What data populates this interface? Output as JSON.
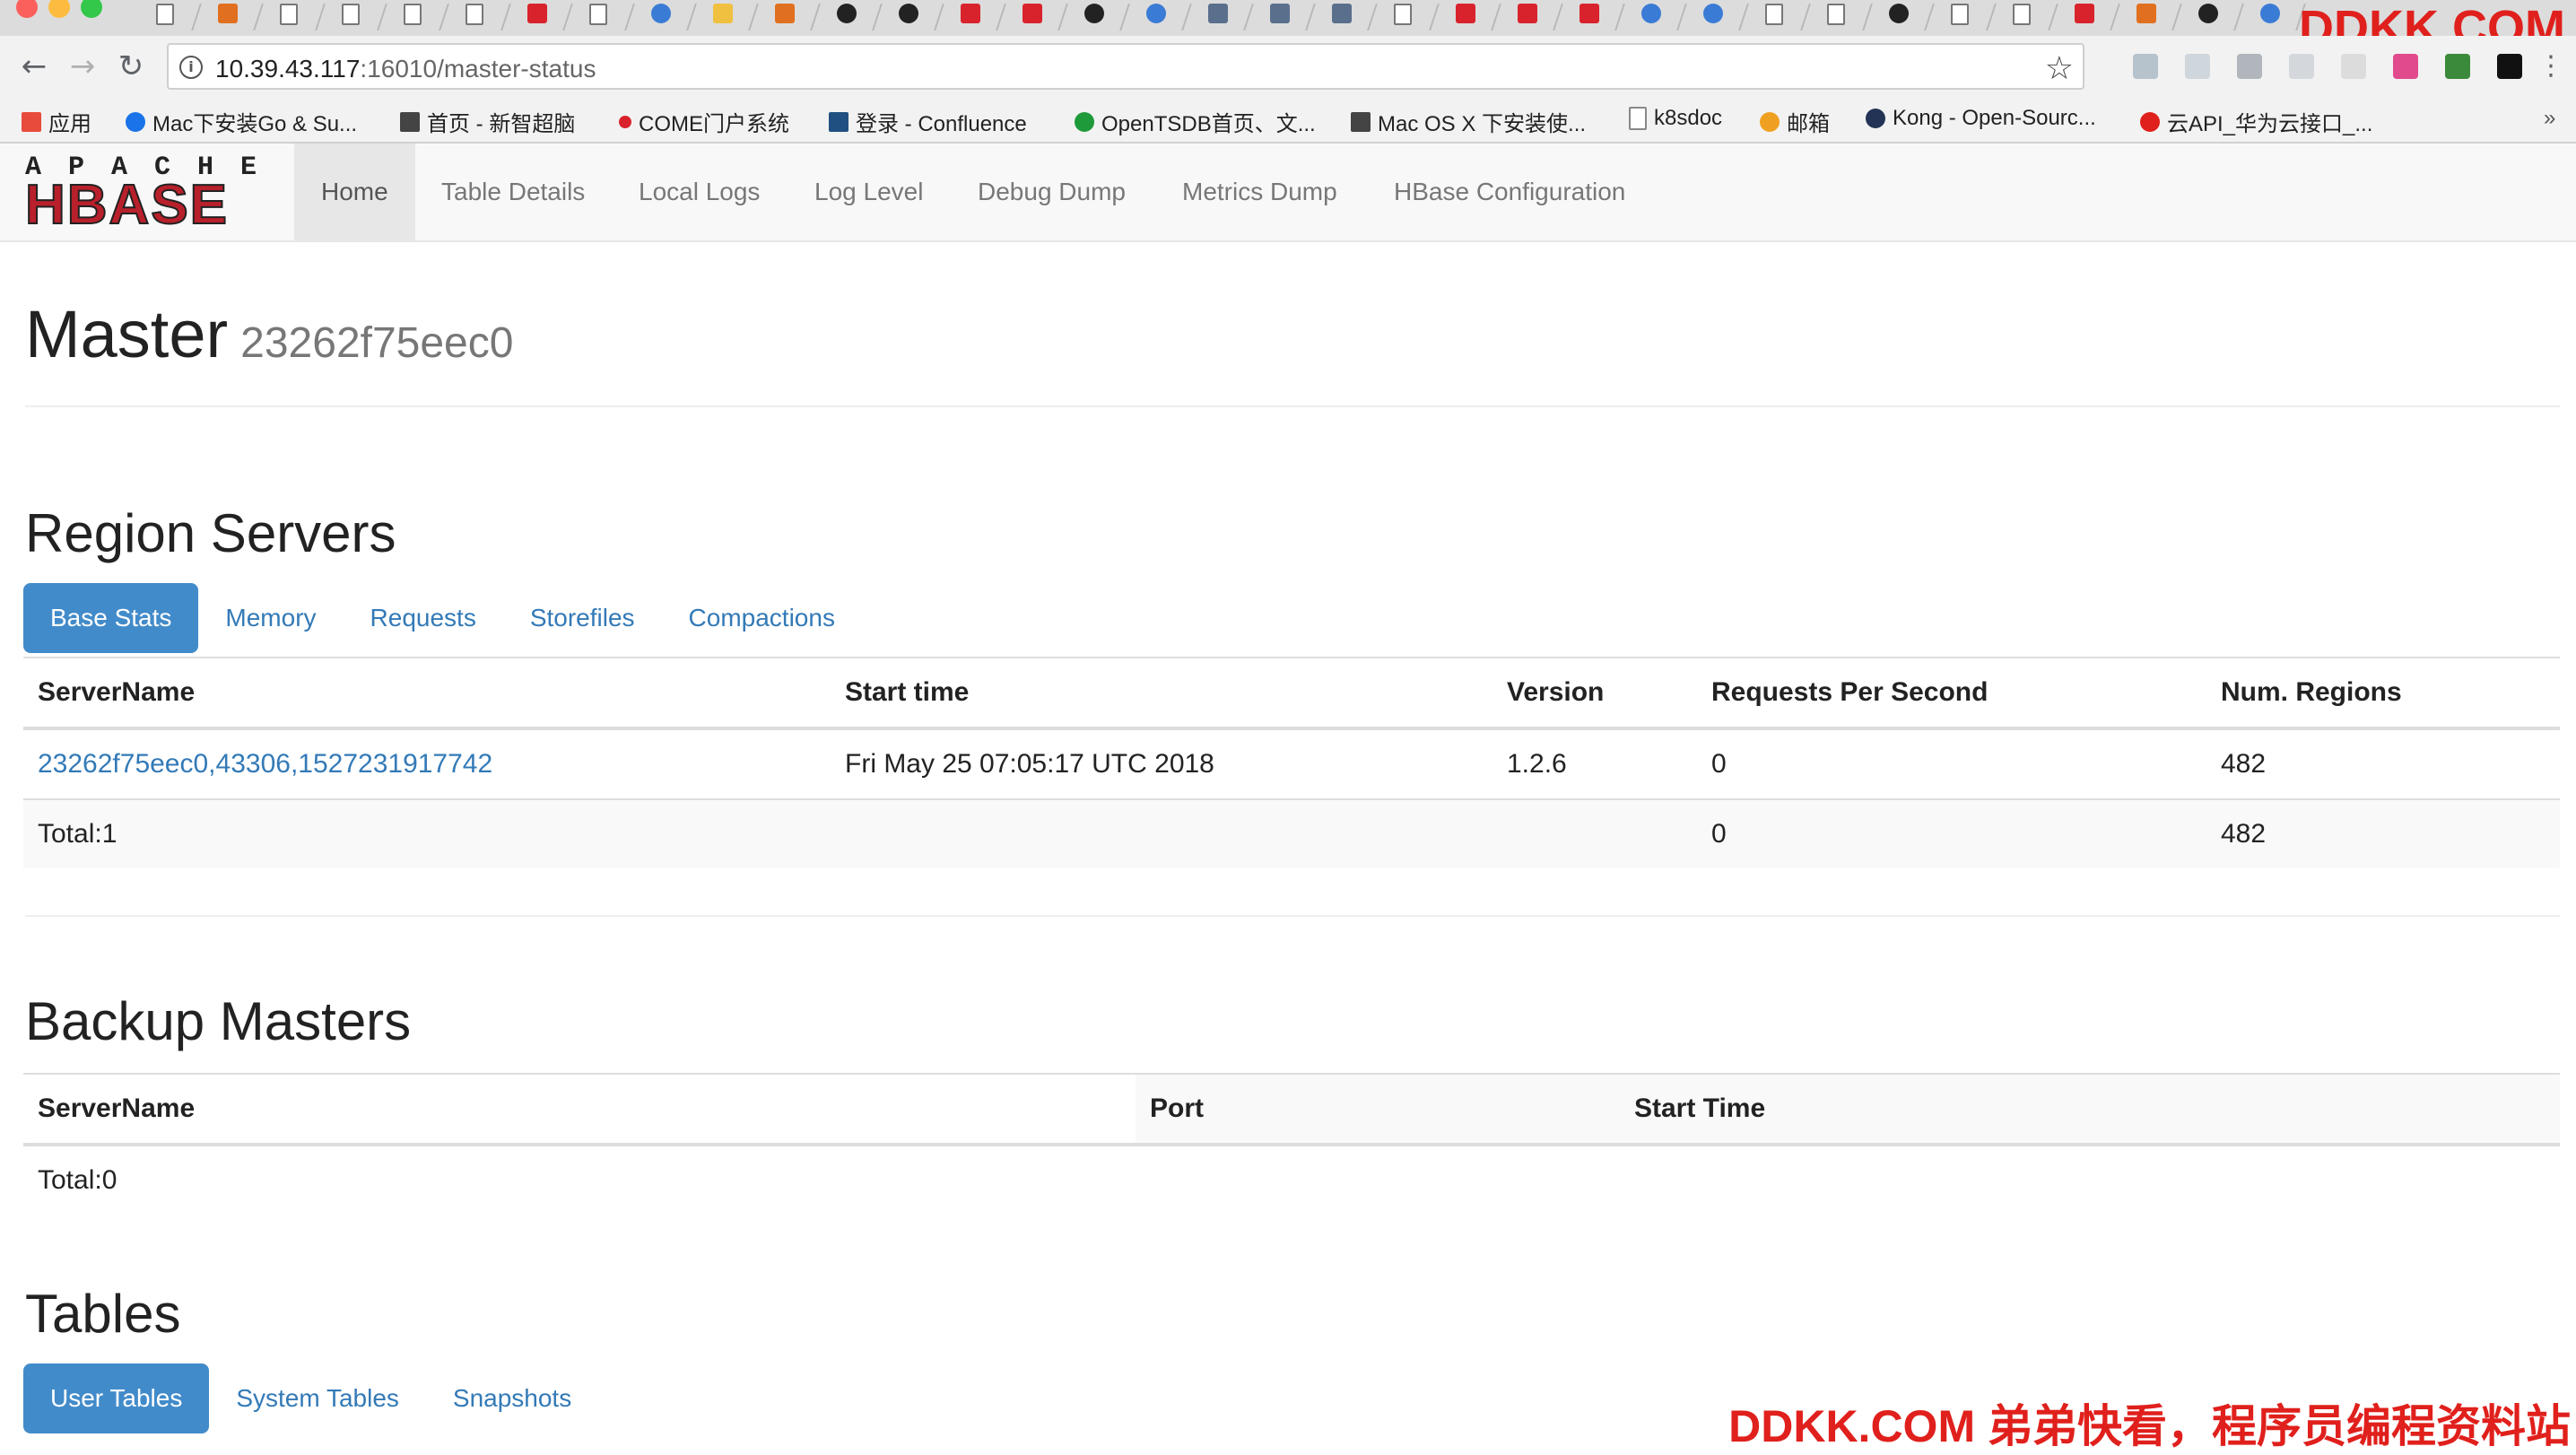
{
  "browser": {
    "tabs": [
      "doc",
      "face",
      "doc",
      "doc",
      "doc",
      "doc",
      "red",
      "doc",
      "avatar",
      "pencil",
      "orange",
      "gh",
      "gh",
      "red",
      "red",
      "gh",
      "blue",
      "grid",
      "grid",
      "grid",
      "doc",
      "red",
      "red",
      "red",
      "blue",
      "blue",
      "doc",
      "doc",
      "gh",
      "doc",
      "doc",
      "red",
      "orange",
      "gh",
      "blue"
    ],
    "url_host": "10.39.43.117",
    "url_rest": ":16010/master-status",
    "bookmarks": [
      {
        "label": "应用",
        "icon": "apps-grid-icon",
        "color": "#e84b3c"
      },
      {
        "label": "Mac下安装Go & Su...",
        "icon": "c-icon",
        "color": "#1a73e8"
      },
      {
        "label": "首页 - 新智超脑",
        "icon": "edit-icon",
        "color": "#444444"
      },
      {
        "label": "COME门户系统",
        "icon": "come-icon",
        "color": "#d9232c"
      },
      {
        "label": "登录 - Confluence",
        "icon": "confluence-icon",
        "color": "#205081"
      },
      {
        "label": "OpenTSDB首页、文...",
        "icon": "c-green-icon",
        "color": "#1e9a3a"
      },
      {
        "label": "Mac OS X 下安装使...",
        "icon": "edit-icon",
        "color": "#444444"
      },
      {
        "label": "k8sdoc",
        "icon": "doc-icon",
        "color": "#888888"
      },
      {
        "label": "邮箱",
        "icon": "mail-icon",
        "color": "#f0a020"
      },
      {
        "label": "Kong - Open-Sourc...",
        "icon": "kong-icon",
        "color": "#223355"
      },
      {
        "label": "云API_华为云接口_...",
        "icon": "huawei-icon",
        "color": "#e0201c"
      }
    ],
    "more_chevron": "»"
  },
  "watermark": {
    "top": "DDKK.COM",
    "bottom": "DDKK.COM 弟弟快看，程序员编程资料站"
  },
  "logo": {
    "top": "APACHE",
    "main": "HBASE"
  },
  "nav": {
    "items": [
      "Home",
      "Table Details",
      "Local Logs",
      "Log Level",
      "Debug Dump",
      "Metrics Dump",
      "HBase Configuration"
    ]
  },
  "master": {
    "title": "Master",
    "host": "23262f75eec0"
  },
  "region_servers": {
    "heading": "Region Servers",
    "tabs": [
      "Base Stats",
      "Memory",
      "Requests",
      "Storefiles",
      "Compactions"
    ],
    "columns": [
      "ServerName",
      "Start time",
      "Version",
      "Requests Per Second",
      "Num. Regions"
    ],
    "rows": [
      {
        "server": "23262f75eec0,43306,1527231917742",
        "start": "Fri May 25 07:05:17 UTC 2018",
        "version": "1.2.6",
        "rps": "0",
        "regions": "482"
      }
    ],
    "total": {
      "label": "Total:1",
      "rps": "0",
      "regions": "482"
    }
  },
  "backup_masters": {
    "heading": "Backup Masters",
    "columns": [
      "ServerName",
      "Port",
      "Start Time"
    ],
    "total": "Total:0"
  },
  "tables": {
    "heading": "Tables",
    "tabs": [
      "User Tables",
      "System Tables",
      "Snapshots"
    ]
  }
}
